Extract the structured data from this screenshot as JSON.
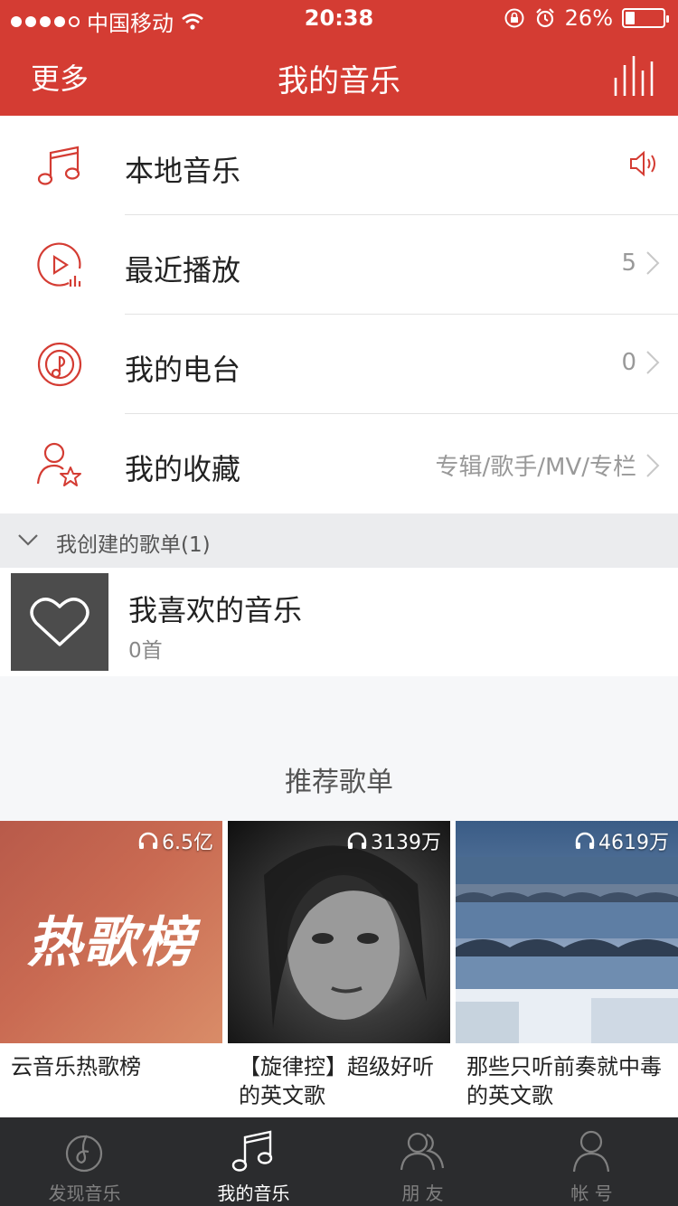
{
  "status_bar": {
    "carrier": "中国移动",
    "time": "20:38",
    "battery": "26%",
    "battery_level": 0.26
  },
  "nav": {
    "more": "更多",
    "title": "我的音乐"
  },
  "menu": [
    {
      "label": "本地音乐",
      "right": "",
      "icon": "music-note-icon"
    },
    {
      "label": "最近播放",
      "right": "5",
      "icon": "recent-play-icon"
    },
    {
      "label": "我的电台",
      "right": "0",
      "icon": "radio-icon"
    },
    {
      "label": "我的收藏",
      "right": "专辑/歌手/MV/专栏",
      "icon": "collection-icon"
    }
  ],
  "created_section": {
    "title": "我创建的歌单(1)"
  },
  "playlist": {
    "name": "我喜欢的音乐",
    "count": "0首"
  },
  "recommend": {
    "title": "推荐歌单",
    "items": [
      {
        "plays": "6.5亿",
        "title": "云音乐热歌榜",
        "cover_text": "热歌榜"
      },
      {
        "plays": "3139万",
        "title": "【旋律控】超级好听的英文歌"
      },
      {
        "plays": "4619万",
        "title": "那些只听前奏就中毒的英文歌"
      }
    ]
  },
  "tabs": [
    {
      "label": "发现音乐",
      "active": false
    },
    {
      "label": "我的音乐",
      "active": true
    },
    {
      "label": "朋 友",
      "active": false
    },
    {
      "label": "帐 号",
      "active": false
    }
  ],
  "colors": {
    "brand": "#d43c33",
    "tabbar": "#2b2c2e"
  }
}
